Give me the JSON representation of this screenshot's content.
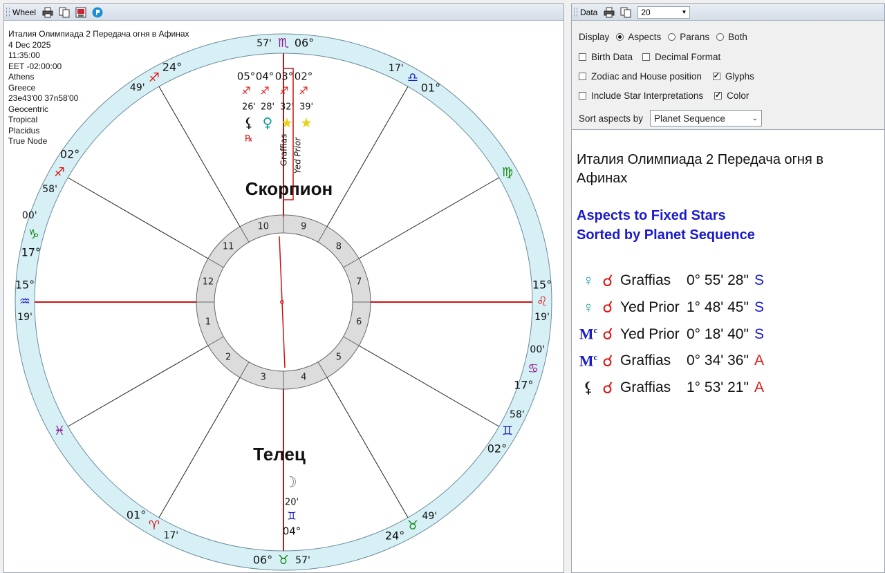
{
  "wheel_panel": {
    "title": "Wheel"
  },
  "chart_info": {
    "lines": [
      "Италия Олимпиада 2 Передача огня в Афинах",
      "4 Dec 2025",
      "11:35:00",
      "EET -02:00:00",
      "Athens",
      "Greece",
      "23e43'00 37n58'00",
      "Geocentric",
      "Tropical",
      "Placidus",
      "True Node"
    ]
  },
  "wheel": {
    "cusps": [
      {
        "house": 1,
        "deg": "15°",
        "glyph": "♒",
        "min": "19'",
        "sign_color": "#1a1acc"
      },
      {
        "house": 2,
        "deg": "",
        "glyph": "♓",
        "min": "",
        "sign_color": "#8a1a8a"
      },
      {
        "house": 3,
        "deg": "01°",
        "glyph": "♈",
        "min": "17'",
        "sign_color": "#dd1111"
      },
      {
        "house": 4,
        "deg": "06°",
        "glyph": "♉",
        "min": "57'",
        "sign_color": "#118811"
      },
      {
        "house": 5,
        "deg": "24°",
        "glyph": "♉",
        "min": "49'",
        "sign_color": "#118811"
      },
      {
        "house": 6,
        "deg": "02°",
        "glyph": "♊",
        "min": "58'",
        "sign_color": "#1a1acc"
      },
      {
        "house": 7,
        "deg": "15°",
        "glyph": "♌",
        "min": "19'",
        "sign_color": "#dd1111"
      },
      {
        "house": 8,
        "deg": "",
        "glyph": "♍",
        "min": "",
        "sign_color": "#118811"
      },
      {
        "house": 9,
        "deg": "01°",
        "glyph": "♎",
        "min": "17'",
        "sign_color": "#1a1acc"
      },
      {
        "house": 10,
        "deg": "06°",
        "glyph": "♏",
        "min": "57'",
        "sign_color": "#8a1a8a"
      },
      {
        "house": 11,
        "deg": "24°",
        "glyph": "♐",
        "min": "49'",
        "sign_color": "#dd1111"
      },
      {
        "house": 12,
        "deg": "02°",
        "glyph": "♐",
        "min": "58'",
        "sign_color": "#dd1111"
      }
    ],
    "extra_cusp_labels": [
      {
        "deg": "00'",
        "glyph": "♑",
        "min": "17°",
        "sign_color": "#118811"
      },
      {
        "deg": "00'",
        "glyph": "♋",
        "min": "17°",
        "sign_color": "#8a1a8a"
      }
    ],
    "house_numbers": [
      "1",
      "2",
      "3",
      "4",
      "5",
      "6",
      "7",
      "8",
      "9",
      "10",
      "11",
      "12"
    ],
    "top_planets": {
      "degrees": [
        "05°",
        "04°",
        "03°",
        "02°"
      ],
      "sign_glyph": "♐",
      "minutes": [
        "26'",
        "28'",
        "32'",
        "39'"
      ],
      "glyphs": [
        {
          "g": "⚸",
          "color": "#111111"
        },
        {
          "g": "♀",
          "color": "#119999"
        },
        {
          "g": "★",
          "color": "#e6d21a"
        },
        {
          "g": "★",
          "color": "#e6d21a"
        }
      ],
      "retro": "℞",
      "star_names": [
        "Graffias",
        "Yed Prior"
      ]
    },
    "moon": {
      "glyph": "☽",
      "min": "20'",
      "sign_glyph": "♊",
      "deg": "04°",
      "color": "#777777",
      "sign_color": "#1a1acc"
    },
    "labels": {
      "upper": "Скорпион",
      "lower": "Телец"
    }
  },
  "data_panel": {
    "title": "Data",
    "count": "20",
    "display_label": "Display",
    "display_options": [
      "Aspects",
      "Parans",
      "Both"
    ],
    "display_selected": 0,
    "checkboxes": [
      {
        "label": "Birth Data",
        "checked": false
      },
      {
        "label": "Decimal Format",
        "checked": false
      },
      {
        "label": "Zodiac and House position",
        "checked": false
      },
      {
        "label": "Glyphs",
        "checked": true
      },
      {
        "label": "Include Star Interpretations",
        "checked": false
      },
      {
        "label": "Color",
        "checked": true
      }
    ],
    "sort_label": "Sort aspects by",
    "sort_value": "Planet Sequence",
    "check_mark": "✓"
  },
  "report": {
    "title": "Италия Олимпиада 2 Передача огня в Афинах",
    "heading1": "Aspects to Fixed Stars",
    "heading2": "Sorted by Planet Sequence",
    "conj_glyph": "☌",
    "aspects": [
      {
        "planet": "♀",
        "planet_color": "#119999",
        "star": "Graffias",
        "orb": "0° 55' 28\"",
        "sa": "S",
        "sa_color": "#1a1acc"
      },
      {
        "planet": "♀",
        "planet_color": "#119999",
        "star": "Yed Prior",
        "orb": "1° 48' 45\"",
        "sa": "S",
        "sa_color": "#1a1acc"
      },
      {
        "planet": "Mc",
        "planet_color": "#1a1acc",
        "star": "Yed Prior",
        "orb": "0° 18' 40\"",
        "sa": "S",
        "sa_color": "#1a1acc"
      },
      {
        "planet": "Mc",
        "planet_color": "#1a1acc",
        "star": "Graffias",
        "orb": "0° 34' 36\"",
        "sa": "A",
        "sa_color": "#dd1111"
      },
      {
        "planet": "⚸",
        "planet_color": "#111111",
        "star": "Graffias",
        "orb": "1° 53' 21\"",
        "sa": "A",
        "sa_color": "#dd1111"
      }
    ]
  },
  "colors": {
    "axis": "#cc1111",
    "ring": "#d6f0f6",
    "house_ring": "#dcdcdc",
    "heading": "#1a1acc"
  }
}
